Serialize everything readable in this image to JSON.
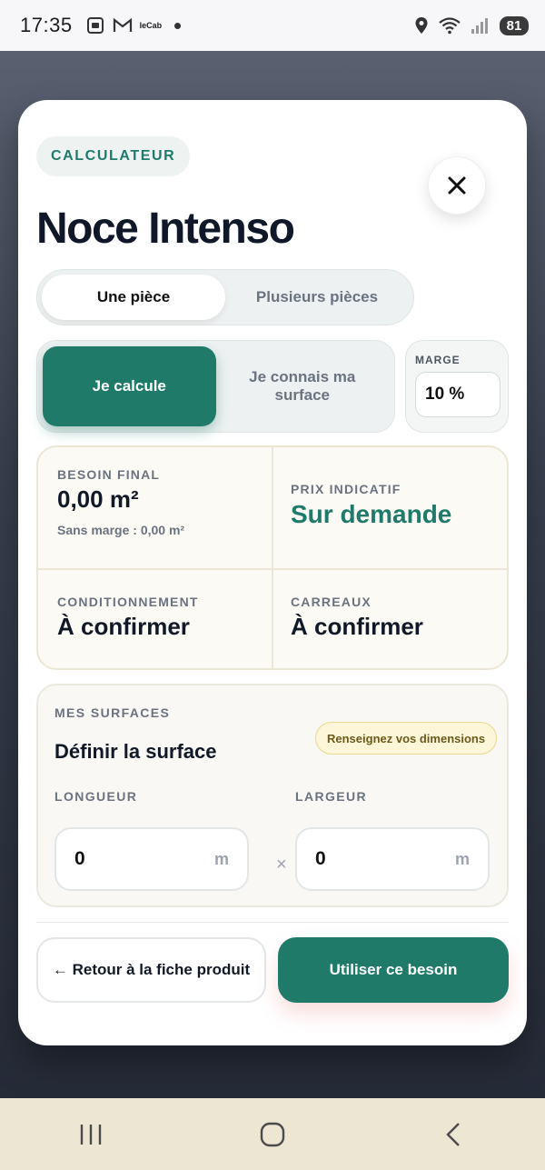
{
  "status_bar": {
    "time": "17:35",
    "carrier_label": "leCab",
    "battery": "81",
    "icons": [
      "screenshot-icon",
      "gmail-icon",
      "location-icon",
      "wifi-icon",
      "signal-icon"
    ]
  },
  "modal": {
    "badge": "CALCULATEUR",
    "title": "Noce Intenso",
    "close_icon": "close-icon",
    "room_toggle": {
      "options": [
        "Une pièce",
        "Plusieurs pièces"
      ],
      "selected": "Une pièce"
    },
    "mode_toggle": {
      "options": [
        "Je calcule",
        "Je connais ma surface"
      ],
      "selected": "Je calcule"
    },
    "marge": {
      "label": "MARGE",
      "value": "10 %"
    },
    "summary": {
      "besoin_final": {
        "label": "BESOIN FINAL",
        "value": "0,00 m²",
        "sub": "Sans marge : 0,00 m²"
      },
      "prix_indicatif": {
        "label": "PRIX INDICATIF",
        "value": "Sur demande"
      },
      "conditionnement": {
        "label": "CONDITIONNEMENT",
        "value": "À confirmer"
      },
      "carreaux": {
        "label": "CARREAUX",
        "value": "À confirmer"
      }
    },
    "surfaces": {
      "header": "MES SURFACES",
      "title": "Définir la surface",
      "hint_badge": "Renseignez vos dimensions",
      "longueur": {
        "label": "LONGUEUR",
        "value": "0",
        "unit": "m"
      },
      "largeur": {
        "label": "LARGEUR",
        "value": "0",
        "unit": "m"
      },
      "times_symbol": "×"
    },
    "actions": {
      "back_label": "← Retour à la fiche produit",
      "use_label": "Utiliser ce besoin"
    }
  },
  "colors": {
    "accent": "#207a6a",
    "hint_badge_bg": "#fdf6d9"
  },
  "nav_bar": {
    "icons": [
      "recents-icon",
      "home-icon",
      "back-icon"
    ]
  }
}
